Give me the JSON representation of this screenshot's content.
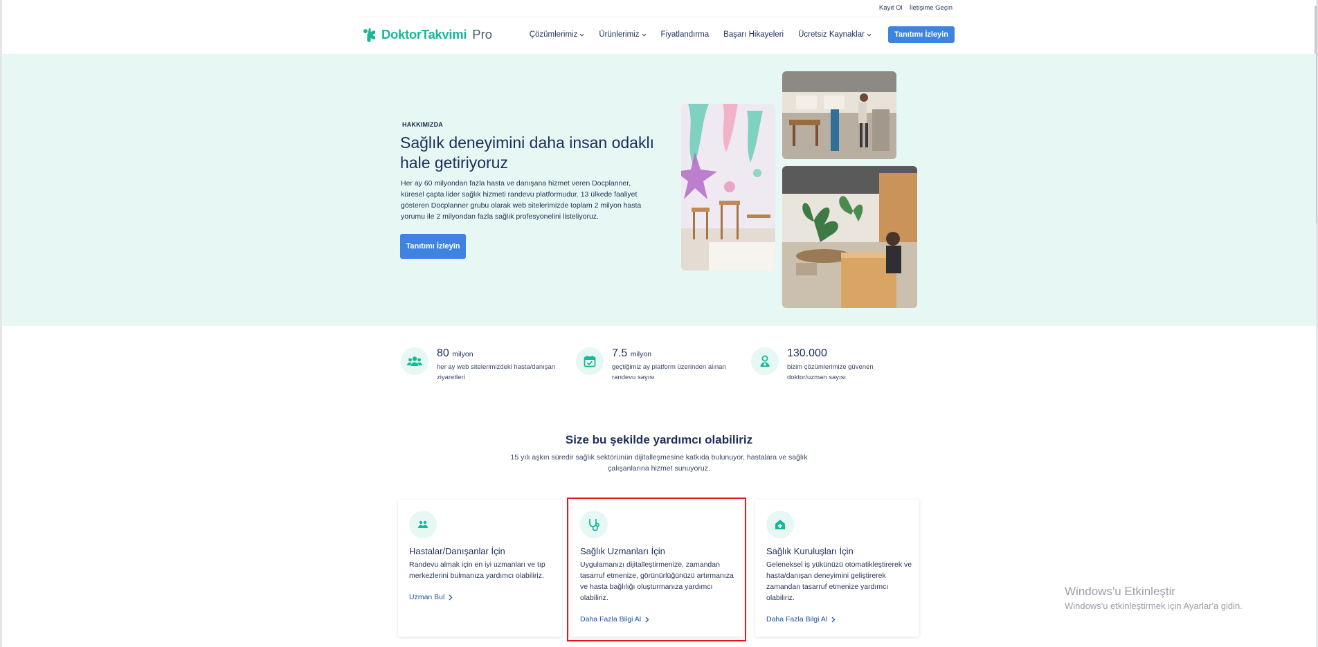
{
  "util": {
    "signup": "Kayıt Ol",
    "contact": "İletişime Geçin"
  },
  "brand": {
    "name": "DoktorTakvimi",
    "suffix": "Pro",
    "color": "#17b897"
  },
  "nav": {
    "items": [
      "Çözümlerimiz",
      "Ürünlerimiz",
      "Fiyatlandırma",
      "Başarı Hikayeleri",
      "Ücretsiz Kaynaklar"
    ],
    "cta": "Tanıtımı İzleyin"
  },
  "hero": {
    "kicker": "HAKKIMIZDA",
    "title": "Sağlık deneyimini daha insan odaklı hale getiriyoruz",
    "description": "Her ay 60 milyondan fazla hasta ve danışana hizmet veren Docplanner, küresel çapta lider sağlık hizmeti randevu platformudur. 13 ülkede faaliyet gösteren Docplanner grubu olarak web sitelerimizde toplam 2 milyon hasta yorumu ile 2 milyondan fazla sağlık profesyonelini listeliyoruz.",
    "button": "Tanıtımı İzleyin"
  },
  "stats": [
    {
      "icon": "users-icon",
      "value": "80",
      "unit": "milyon",
      "desc": "her ay web sitelerimizdeki hasta/danışan ziyaretleri"
    },
    {
      "icon": "calendar-check-icon",
      "value": "7.5",
      "unit": "milyon",
      "desc": "geçtiğimiz ay platform üzerinden alınan randevu sayısı"
    },
    {
      "icon": "doctor-icon",
      "value": "130.000",
      "unit": "",
      "desc": "bizim çözümlerimize güvenen doktor/uzman sayısı"
    }
  ],
  "help": {
    "title": "Size bu şekilde yardımcı olabiliriz",
    "subtitle": "15 yılı aşkın süredir sağlık sektörünün dijitalleşmesine katkıda bulunuyor, hastalara ve sağlık çalışanlarına hizmet sunuyoruz."
  },
  "cards": [
    {
      "icon": "patients-icon",
      "title": "Hastalar/Danışanlar İçin",
      "desc": "Randevu almak için en iyi uzmanları ve tıp merkezlerini bulmanıza yardımcı olabiliriz.",
      "link": "Uzman Bul"
    },
    {
      "icon": "stethoscope-icon",
      "title": "Sağlık Uzmanları İçin",
      "desc": "Uygulamanızı dijitalleştirmenize, zamandan tasarruf etmenize, görünürlüğünüzü artırmanıza ve hasta bağlılığı oluşturmanıza yardımcı olabiliriz.",
      "link": "Daha Fazla Bilgi Al"
    },
    {
      "icon": "clinic-icon",
      "title": "Sağlık Kuruluşları İçin",
      "desc": "Geleneksel iş yükünüzü otomatikleştirerek ve hasta/danışan deneyimini geliştirerek zamandan tasarruf etmenize yardımcı olabiliriz.",
      "link": "Daha Fazla Bilgi Al"
    }
  ],
  "watermark": {
    "line1": "Windows'u Etkinleştir",
    "line2": "Windows'u etkinleştirmek için Ayarlar'a gidin."
  },
  "colors": {
    "accent": "#3d83df",
    "teal": "#17b897",
    "heroBg": "#e6f7f4",
    "highlight": "#e3161a"
  }
}
